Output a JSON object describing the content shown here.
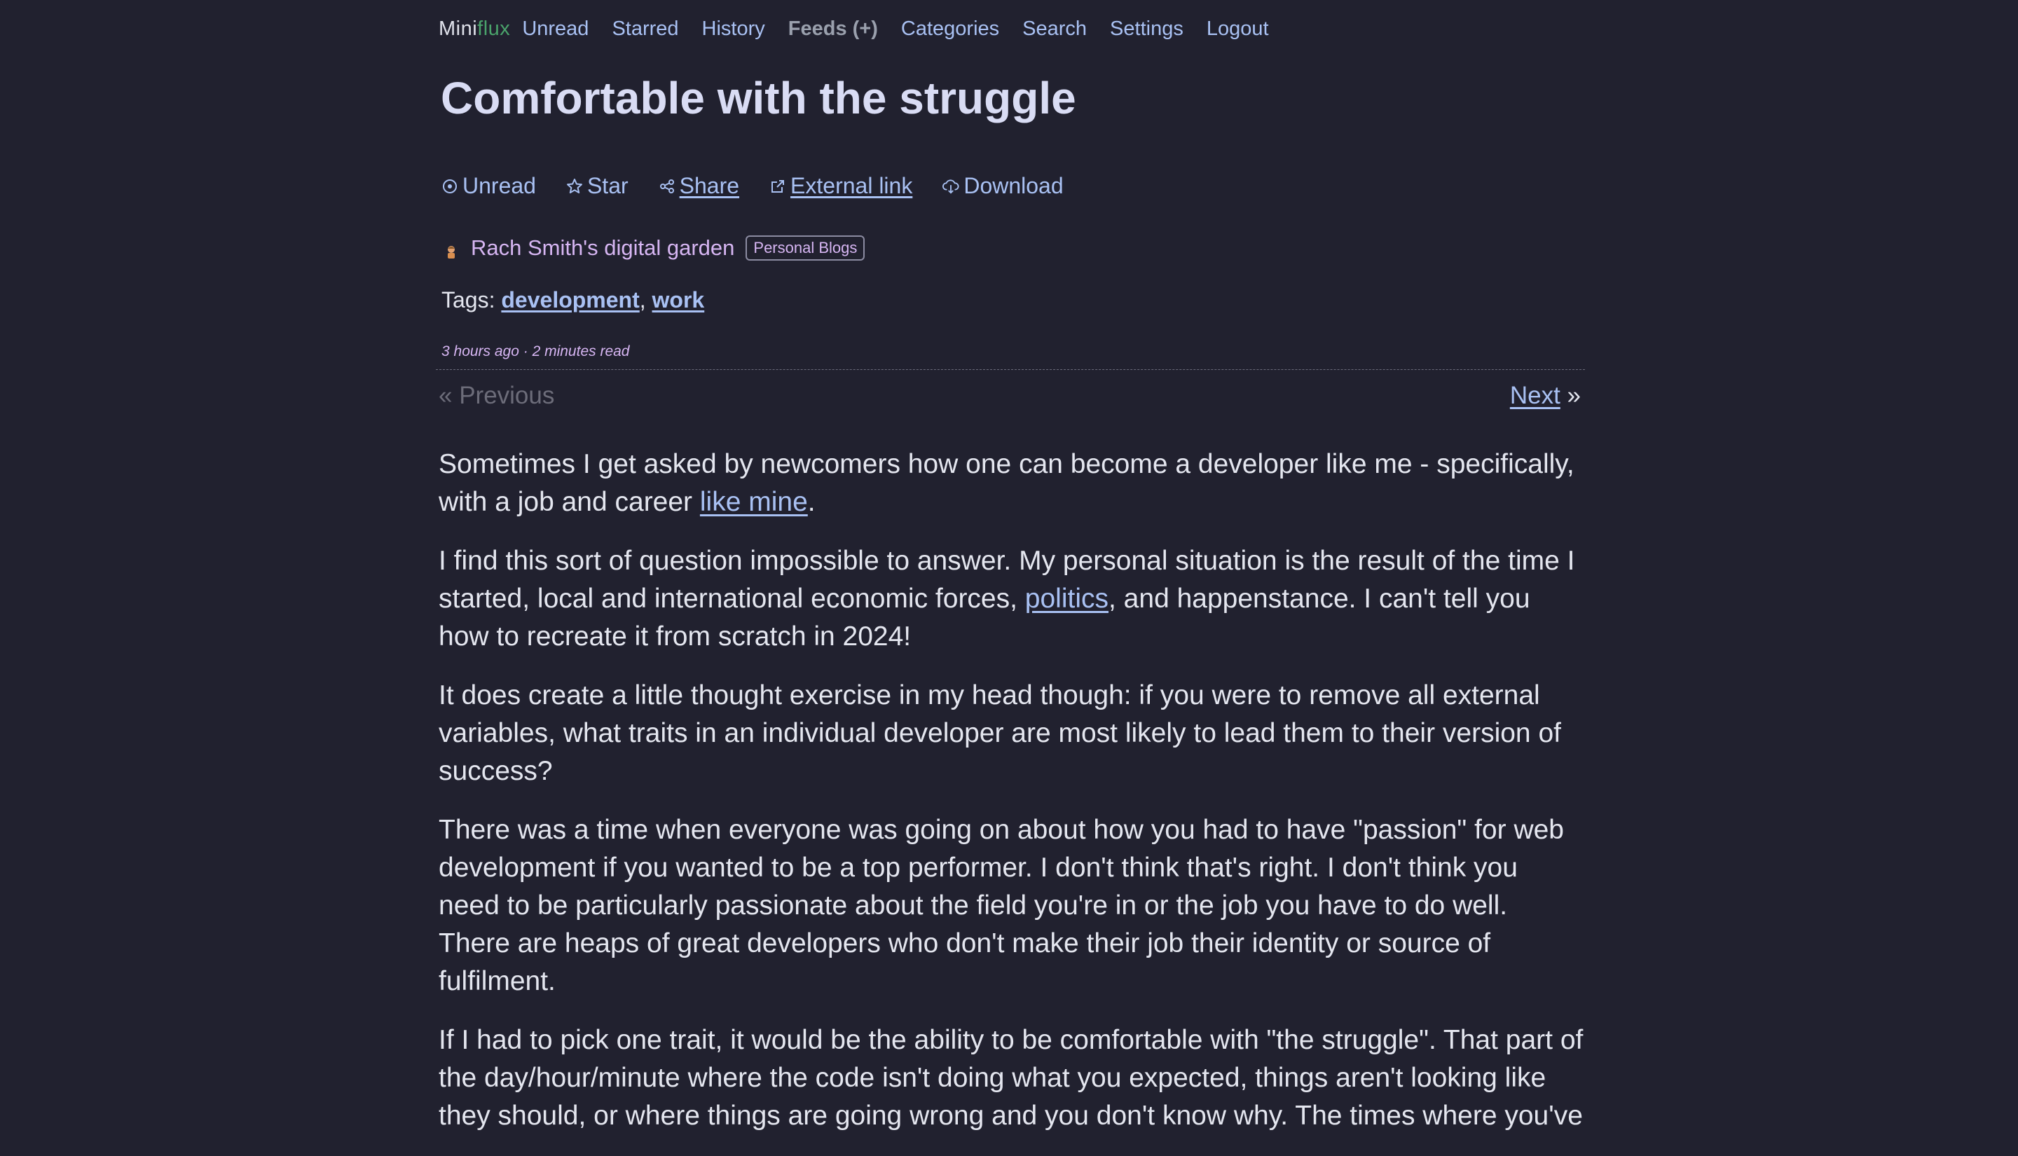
{
  "nav": {
    "logo_mini": "Mini",
    "logo_flux": "flux",
    "items": [
      {
        "label": "Unread"
      },
      {
        "label": "Starred"
      },
      {
        "label": "History"
      },
      {
        "label": "Feeds (+)"
      },
      {
        "label": "Categories"
      },
      {
        "label": "Search"
      },
      {
        "label": "Settings"
      },
      {
        "label": "Logout"
      }
    ]
  },
  "entry": {
    "title": "Comfortable with the struggle",
    "actions": {
      "unread": "Unread",
      "star": "Star",
      "share": "Share",
      "external": "External link",
      "download": "Download"
    },
    "feed_title": "Rach Smith's digital garden",
    "category": "Personal Blogs",
    "tags_label": "Tags: ",
    "tags": [
      "development",
      "work"
    ],
    "tag_separator": ", ",
    "meta": "3 hours ago · 2 minutes read",
    "pager": {
      "previous": "« Previous",
      "next": "Next",
      "next_arrow": " »"
    },
    "content": {
      "p1_a": "Sometimes I get asked by newcomers how one can become a developer like me - specifically, with a job and career ",
      "p1_link": "like mine",
      "p1_b": ".",
      "p2_a": "I find this sort of question impossible to answer. My personal situation is the result of the time I started, local and international economic forces, ",
      "p2_link": "politics",
      "p2_b": ", and happenstance. I can't tell you how to recreate it from scratch in 2024!",
      "p3": "It does create a little thought exercise in my head though: if you were to remove all external variables, what traits in an individual developer are most likely to lead them to their version of success?",
      "p4": "There was a time when everyone was going on about how you had to have \"passion\" for web development if you wanted to be a top performer. I don't think that's right. I don't think you need to be particularly passionate about the field you're in or the job you have to do well. There are heaps of great developers who don't make their job their identity or source of fulfilment.",
      "p5": "If I had to pick one trait, it would be the ability to be comfortable with \"the struggle\". That part of the day/hour/minute where the code isn't doing what you expected, things aren't looking like they should, or where things are going wrong and you don't know why. The times where you've"
    }
  }
}
